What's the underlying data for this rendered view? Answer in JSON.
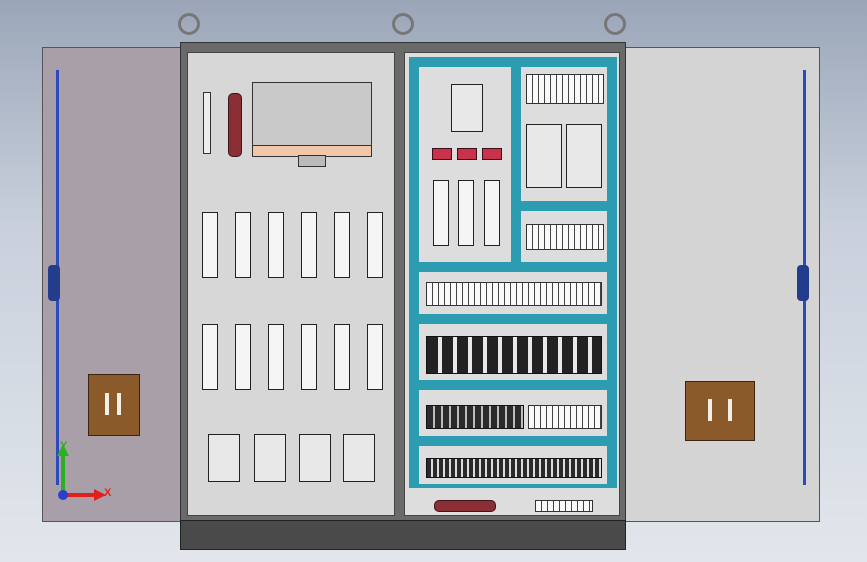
{
  "axes": {
    "y_label": "Y",
    "x_label": "X"
  },
  "colors": {
    "rail": "#2c9db0",
    "rod": "#2a4bb8",
    "lock": "#8a5a2a",
    "busbar": "#8a2f36",
    "axis_x": "#e0201a",
    "axis_y": "#2ab020"
  }
}
